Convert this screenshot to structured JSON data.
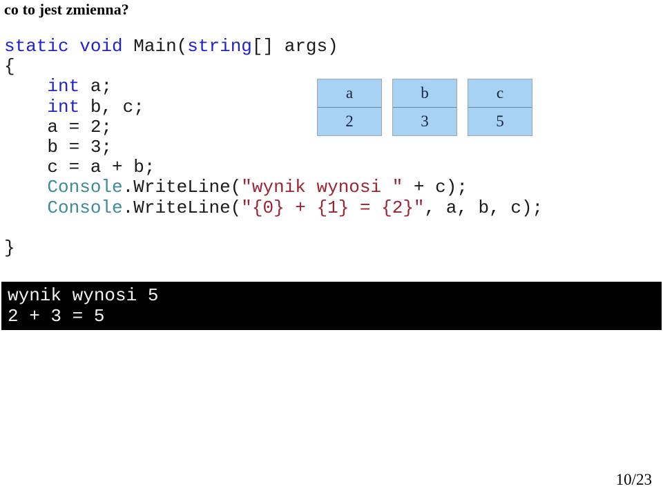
{
  "slide": {
    "title": "co to jest zmienna?",
    "page_number": "10/23"
  },
  "code": {
    "language": "csharp",
    "lines": [
      {
        "id": "line-signature",
        "tokens": [
          {
            "text": "static",
            "kind": "keyword"
          },
          {
            "text": " ",
            "kind": "plain"
          },
          {
            "text": "void",
            "kind": "keyword"
          },
          {
            "text": " Main(",
            "kind": "plain"
          },
          {
            "text": "string",
            "kind": "type"
          },
          {
            "text": "[] args)",
            "kind": "plain"
          }
        ]
      },
      {
        "id": "line-open-brace",
        "tokens": [
          {
            "text": "{",
            "kind": "plain"
          }
        ]
      },
      {
        "id": "line-decl-a",
        "tokens": [
          {
            "text": "    ",
            "kind": "plain"
          },
          {
            "text": "int",
            "kind": "type"
          },
          {
            "text": " a;",
            "kind": "plain"
          }
        ]
      },
      {
        "id": "line-decl-bc",
        "tokens": [
          {
            "text": "    ",
            "kind": "plain"
          },
          {
            "text": "int",
            "kind": "type"
          },
          {
            "text": " b, c;",
            "kind": "plain"
          }
        ]
      },
      {
        "id": "line-assign-a",
        "tokens": [
          {
            "text": "    a = 2;",
            "kind": "plain"
          }
        ]
      },
      {
        "id": "line-assign-b",
        "tokens": [
          {
            "text": "    b = 3;",
            "kind": "plain"
          }
        ]
      },
      {
        "id": "line-assign-c",
        "tokens": [
          {
            "text": "    c = a + b;",
            "kind": "plain"
          }
        ]
      },
      {
        "id": "line-writeline-1",
        "tokens": [
          {
            "text": "    ",
            "kind": "plain"
          },
          {
            "text": "Console",
            "kind": "class"
          },
          {
            "text": ".WriteLine(",
            "kind": "plain"
          },
          {
            "text": "\"wynik wynosi \"",
            "kind": "string"
          },
          {
            "text": " + c);",
            "kind": "plain"
          }
        ]
      },
      {
        "id": "line-writeline-2",
        "tokens": [
          {
            "text": "    ",
            "kind": "plain"
          },
          {
            "text": "Console",
            "kind": "class"
          },
          {
            "text": ".WriteLine(",
            "kind": "plain"
          },
          {
            "text": "\"{0} + {1} = {2}\"",
            "kind": "string"
          },
          {
            "text": ", a, b, c);",
            "kind": "plain"
          }
        ]
      },
      {
        "id": "line-gap",
        "tokens": [
          {
            "text": " ",
            "kind": "plain"
          }
        ]
      },
      {
        "id": "line-close-brace",
        "tokens": [
          {
            "text": "}",
            "kind": "plain"
          }
        ]
      }
    ]
  },
  "variables": {
    "headers": [
      "a",
      "b",
      "c"
    ],
    "values": [
      "2",
      "3",
      "5"
    ],
    "box_fill": "#a8d2f4",
    "box_border": "#9aa7b0",
    "text_color": "#16233d"
  },
  "console": {
    "background": "#000000",
    "text_color": "#f2f2f2",
    "lines": [
      "wynik wynosi 5",
      "2 + 3 = 5"
    ]
  },
  "colors": {
    "keyword": "#2222cc",
    "type": "#2222cc",
    "class": "#3d8b96",
    "string": "#9b2335",
    "plain": "#1a1a1a"
  }
}
